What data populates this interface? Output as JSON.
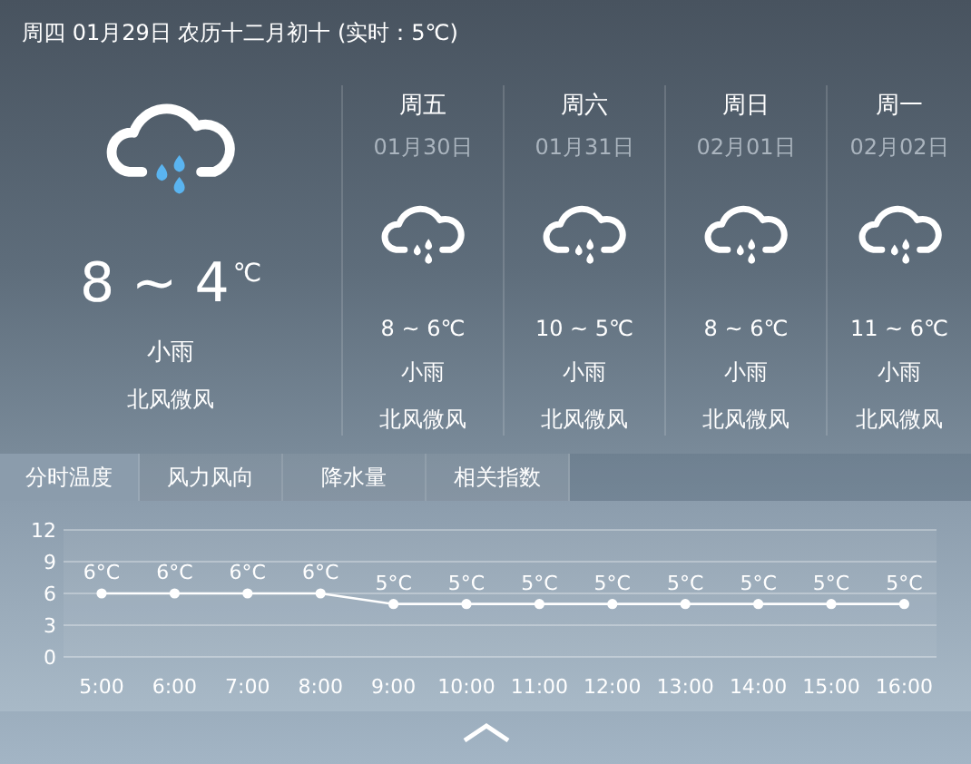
{
  "header": {
    "text": "周四 01月29日 农历十二月初十 (实时：5℃)"
  },
  "today": {
    "temp": "8 ~ 4",
    "unit": "℃",
    "weather": "小雨",
    "wind": "北风微风"
  },
  "forecast": [
    {
      "day": "周五",
      "date": "01月30日",
      "temp": "8 ~ 6℃",
      "weather": "小雨",
      "wind": "北风微风"
    },
    {
      "day": "周六",
      "date": "01月31日",
      "temp": "10 ~ 5℃",
      "weather": "小雨",
      "wind": "北风微风"
    },
    {
      "day": "周日",
      "date": "02月01日",
      "temp": "8 ~ 6℃",
      "weather": "小雨",
      "wind": "北风微风"
    },
    {
      "day": "周一",
      "date": "02月02日",
      "temp": "11 ~ 6℃",
      "weather": "小雨",
      "wind": "北风微风"
    }
  ],
  "tabs": [
    {
      "label": "分时温度",
      "selected": true
    },
    {
      "label": "风力风向",
      "selected": false
    },
    {
      "label": "降水量",
      "selected": false
    },
    {
      "label": "相关指数",
      "selected": false
    }
  ],
  "chart": {
    "chart_data": {
      "type": "line",
      "categories": [
        "5:00",
        "6:00",
        "7:00",
        "8:00",
        "9:00",
        "10:00",
        "11:00",
        "12:00",
        "13:00",
        "14:00",
        "15:00",
        "16:00"
      ],
      "series": [
        {
          "color": "#ffffff",
          "marker": "circle",
          "values": [
            6,
            6,
            6,
            6,
            5,
            5,
            5,
            5,
            5,
            5,
            5,
            5
          ]
        }
      ],
      "grid": true,
      "ylim": [
        0,
        12
      ],
      "yticks": [
        0,
        3,
        6,
        9,
        12
      ],
      "value_labels": [
        "6°C",
        "6°C",
        "6°C",
        "6°C",
        "5°C",
        "5°C",
        "5°C",
        "5°C",
        "5°C",
        "5°C",
        "5°C",
        "5°C"
      ]
    }
  }
}
